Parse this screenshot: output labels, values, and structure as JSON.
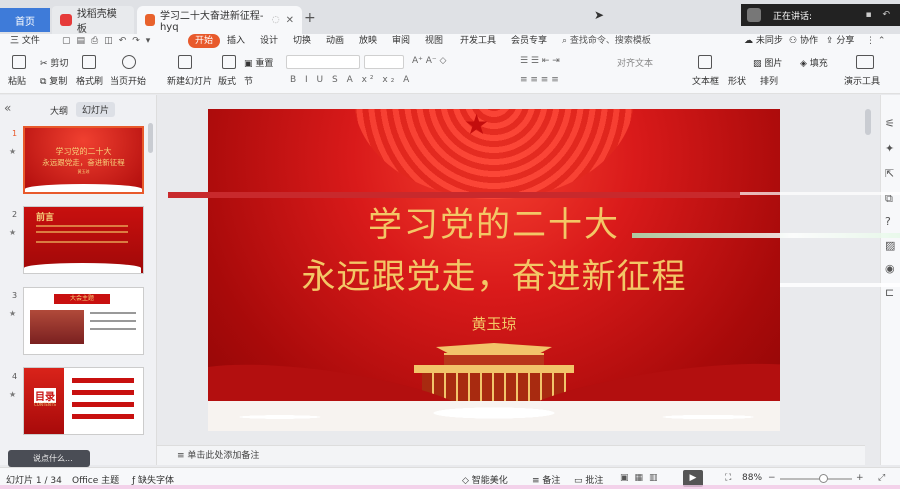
{
  "tabs": {
    "home": "首页",
    "template": "找稻壳模板",
    "document": "学习二十大奋进新征程- hyq"
  },
  "speaker": "正在讲话:",
  "menu": {
    "file": "三 文件",
    "items": [
      "开始",
      "插入",
      "设计",
      "切换",
      "动画",
      "放映",
      "审阅",
      "视图",
      "开发工具",
      "会员专享"
    ],
    "search": "查找命令、搜索模板",
    "unsynced": "未同步",
    "collab": "协作",
    "share": "分享"
  },
  "ribbon": {
    "paste": "粘贴",
    "cut": "剪切",
    "copy": "复制",
    "format_painter": "格式刷",
    "from_current": "当页开始",
    "new_slide": "新建幻灯片",
    "layout": "版式",
    "section": "节",
    "reset": "重置",
    "align_text": "对齐文本",
    "textbox": "文本框",
    "shapes": "形状",
    "arrange": "排列",
    "picture": "图片",
    "fill": "填充",
    "presenter": "演示工具"
  },
  "left_panel": {
    "tab_outline": "大纲",
    "tab_slides": "幻灯片",
    "slide_numbers": [
      "1",
      "2",
      "3",
      "4"
    ],
    "thumb1_line1": "学习党的二十大",
    "thumb1_line2": "永远跟党走，奋进新征程",
    "thumb1_author": "黄玉琼",
    "thumb2_title": "前言",
    "thumb3_title": "大会主题",
    "thumb4_title": "目录",
    "thumb4_en": "CONTENTS",
    "say_something": "说点什么..."
  },
  "slide": {
    "title_line1": "学习党的二十大",
    "title_line2": "永远跟党走，奋进新征程",
    "author": "黄玉琼"
  },
  "notes_placeholder": "单击此处添加备注",
  "status": {
    "slide_counter": "幻灯片 1 / 34",
    "theme": "Office 主题",
    "missing_fonts": "缺失字体",
    "smart_beautify": "智能美化",
    "notes": "备注",
    "comments": "批注",
    "zoom": "88%",
    "zoom_level": 0.6
  },
  "colors": {
    "accent": "#e85a2c",
    "slide_red": "#c8100f",
    "gold": "#f3c766",
    "home_tab": "#3e7bd9"
  }
}
